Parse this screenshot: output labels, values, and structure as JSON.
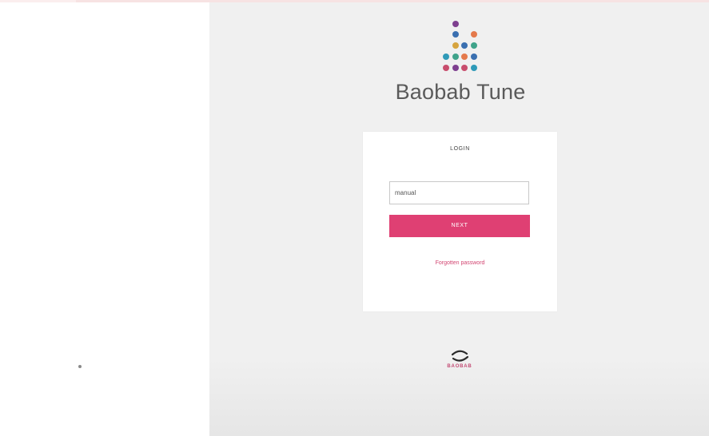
{
  "app": {
    "brand_name": "Baobab Tune",
    "logo_icon": "dot-tree-icon",
    "logo_colors": [
      "#7e3f8f",
      "#3a6fb0",
      "#e4794b",
      "#3fa38a",
      "#c84d6d",
      "#2f9ab8",
      "#d6a43f"
    ]
  },
  "login": {
    "title": "LOGIN",
    "username_value": "manual",
    "next_label": "NEXT",
    "forgot_label": "Forgotten password"
  },
  "footer": {
    "logo_icon": "baobab-swoosh-icon",
    "logo_text": "BAOBAB"
  },
  "colors": {
    "accent": "#df4073",
    "link": "#d24571",
    "background": "#f0f0f0"
  }
}
